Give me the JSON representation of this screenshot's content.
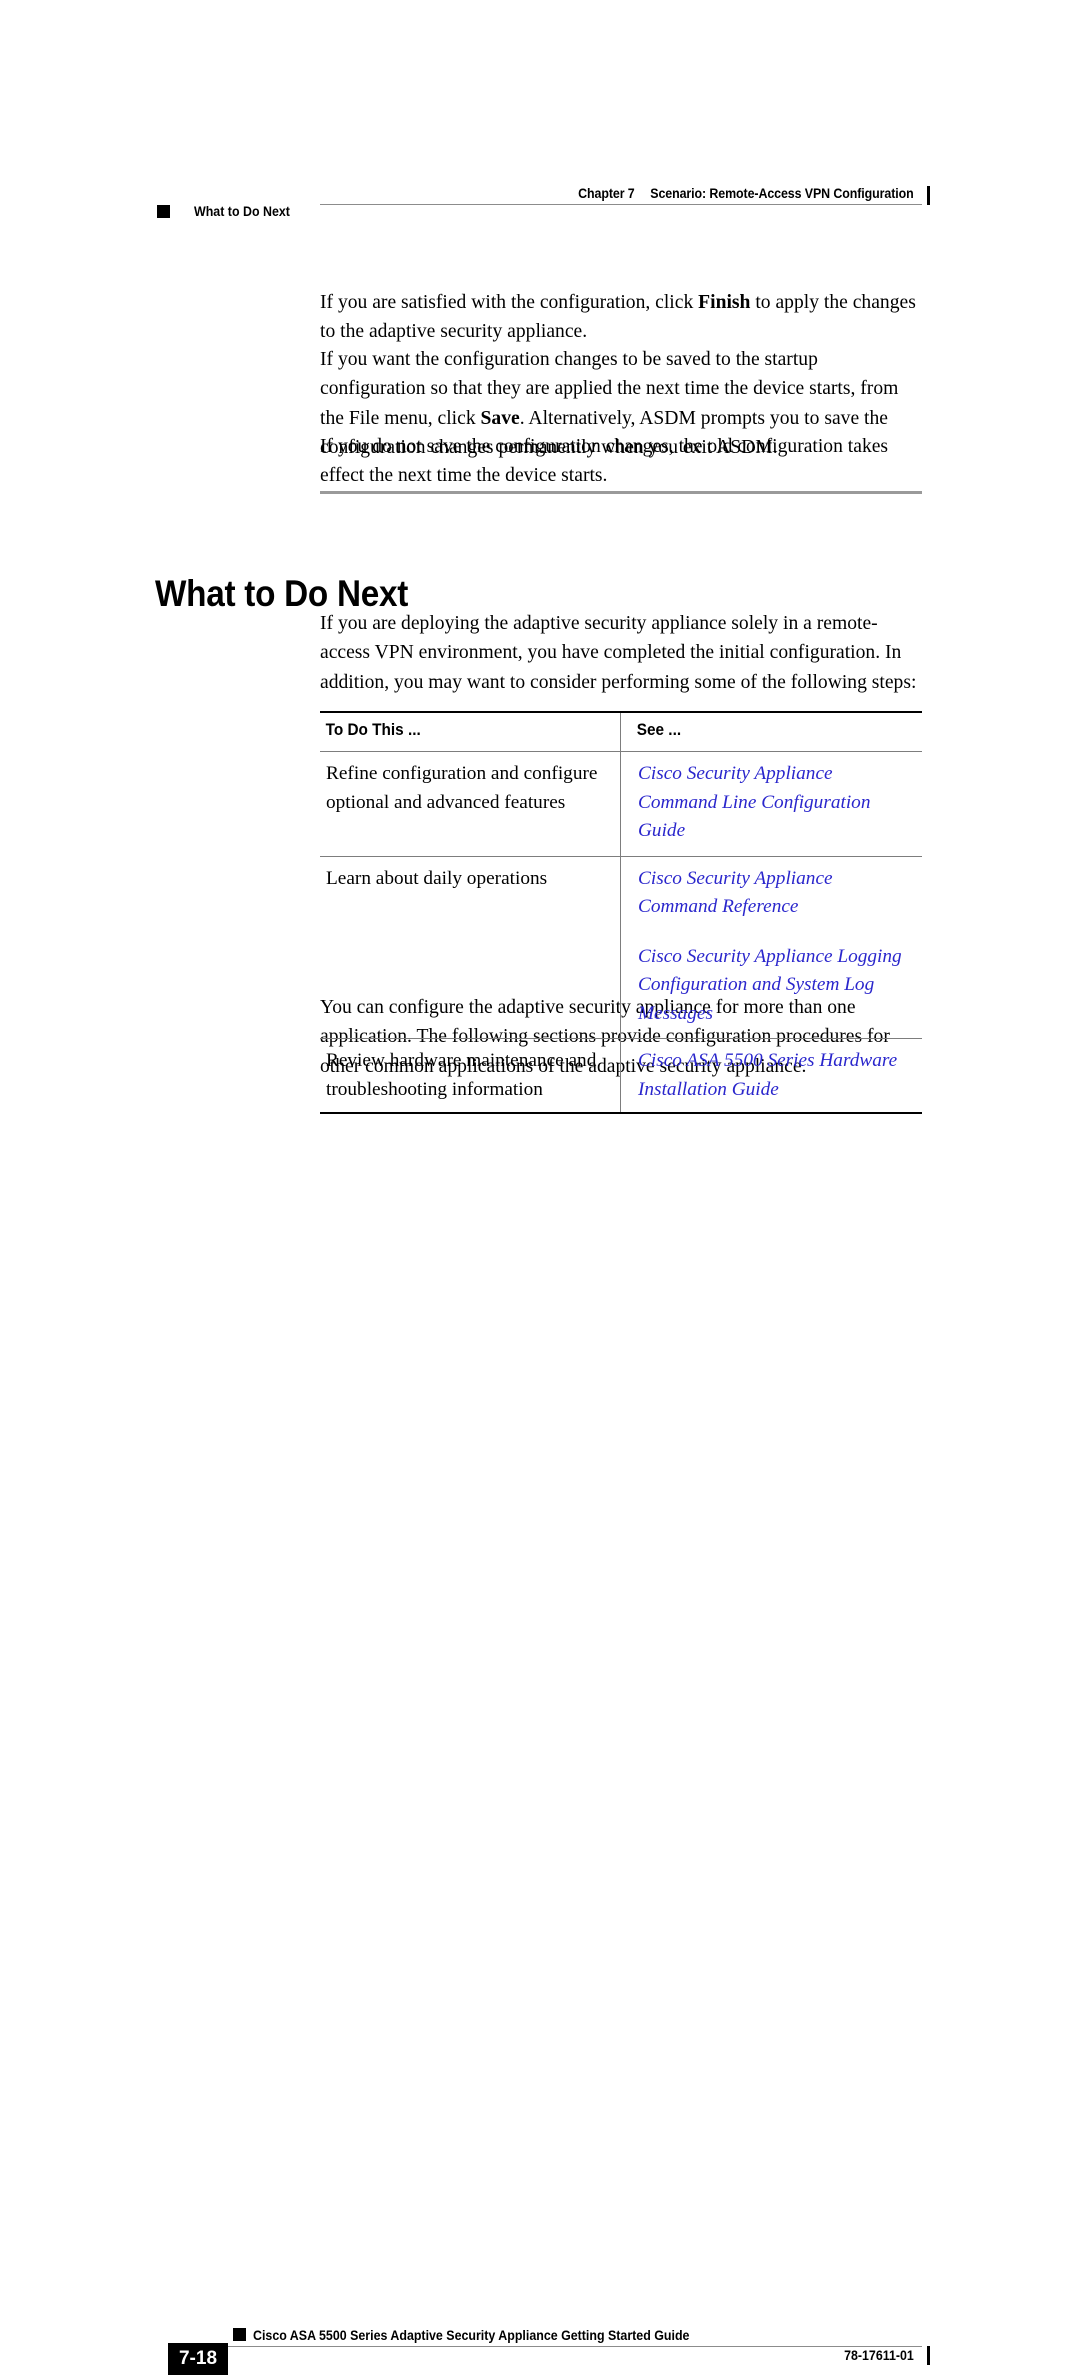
{
  "header": {
    "chapter_label": "Chapter 7",
    "chapter_title": "Scenario: Remote-Access VPN Configuration",
    "section_marker": "square-bullet",
    "section_title": "What to Do Next"
  },
  "body": {
    "paragraph_1_pre": "If you are satisfied with the configuration, click ",
    "paragraph_1_bold": "Finish",
    "paragraph_1_post": " to apply the changes to the adaptive security appliance.",
    "paragraph_2_pre": "If you want the configuration changes to be saved to the startup configuration so that they are applied the next time the device starts, from the File menu, click ",
    "paragraph_2_bold": "Save",
    "paragraph_2_post": ". Alternatively, ASDM prompts you to save the configuration changes permanently when you exit ASDM.",
    "paragraph_3": "If you do not save the configuration changes, the old configuration takes effect the next time the device starts.",
    "paragraph_4": "If you are deploying the adaptive security appliance solely in a remote-access VPN environment, you have completed the initial configuration. In addition, you may want to consider performing some of the following steps:",
    "paragraph_5": "You can configure the adaptive security appliance for more than one application. The following sections provide configuration procedures for other common applications of the adaptive security appliance."
  },
  "section": {
    "heading": "What to Do Next"
  },
  "table": {
    "headers": [
      "To Do This ...",
      "See ..."
    ],
    "rows": [
      {
        "task": "Refine configuration and configure optional and advanced features",
        "references": [
          "Cisco Security Appliance Command Line Configuration Guide"
        ]
      },
      {
        "task": "Learn about daily operations",
        "references": [
          "Cisco Security Appliance Command Reference",
          "Cisco Security Appliance Logging Configuration and System Log Messages"
        ]
      },
      {
        "task": "Review hardware maintenance and troubleshooting information",
        "references": [
          "Cisco ASA 5500 Series Hardware Installation Guide"
        ]
      }
    ]
  },
  "footer": {
    "guide_title": "Cisco ASA 5500 Series Adaptive Security Appliance Getting Started Guide",
    "page_number": "7-18",
    "document_number": "78-17611-01",
    "marker": "square-bullet"
  },
  "colors": {
    "link_blue": "#2a26cc",
    "rule_gray": "#8c8c8c",
    "divider_gray": "#9a9a9a",
    "text_black": "#000000"
  }
}
